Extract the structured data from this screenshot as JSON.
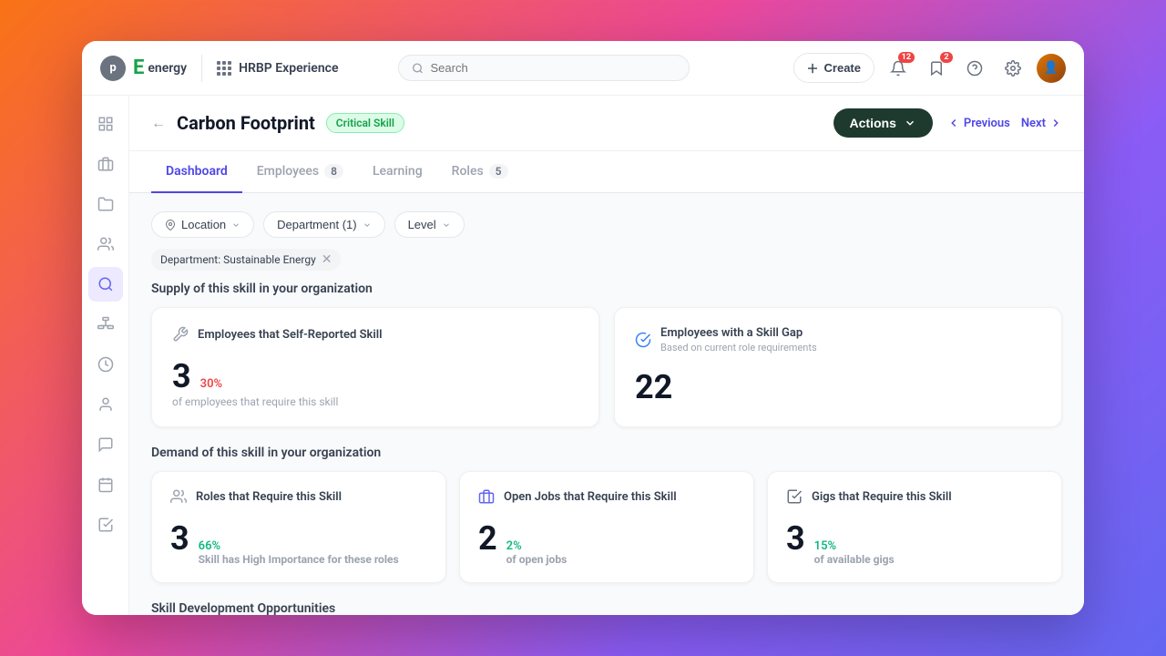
{
  "header": {
    "logo_letter": "E",
    "brand_name": "energy",
    "app_name": "HRBP Experience",
    "search_placeholder": "Search",
    "create_label": "Create",
    "notifications_count": "12",
    "bookmarks_count": "2"
  },
  "sidebar": {
    "items": [
      {
        "name": "dashboard",
        "icon": "⊞",
        "active": false
      },
      {
        "name": "briefcase",
        "icon": "💼",
        "active": false
      },
      {
        "name": "jobs",
        "icon": "🗂️",
        "active": false
      },
      {
        "name": "people",
        "icon": "👥",
        "active": false
      },
      {
        "name": "search",
        "icon": "🔍",
        "active": true
      },
      {
        "name": "org",
        "icon": "🏢",
        "active": false
      },
      {
        "name": "history",
        "icon": "🕐",
        "active": false
      },
      {
        "name": "person",
        "icon": "👤",
        "active": false
      },
      {
        "name": "chat",
        "icon": "💬",
        "active": false
      },
      {
        "name": "calendar",
        "icon": "📅",
        "active": false
      },
      {
        "name": "checklist",
        "icon": "✅",
        "active": false
      }
    ]
  },
  "page": {
    "back_label": "←",
    "title": "Carbon Footprint",
    "badge": "Critical Skill",
    "actions_label": "Actions",
    "prev_label": "Previous",
    "next_label": "Next"
  },
  "tabs": [
    {
      "label": "Dashboard",
      "count": null,
      "active": true
    },
    {
      "label": "Employees",
      "count": "8",
      "active": false
    },
    {
      "label": "Learning",
      "count": null,
      "active": false
    },
    {
      "label": "Roles",
      "count": "5",
      "active": false
    }
  ],
  "filters": {
    "location_label": "Location",
    "department_label": "Department (1)",
    "level_label": "Level",
    "active_tag": "Department: Sustainable Energy"
  },
  "supply_section": {
    "heading": "Supply of this skill in your organization",
    "card1": {
      "title": "Employees that Self-Reported Skill",
      "icon": "wrench",
      "number": "3",
      "percent": "30%",
      "desc": "of employees that require this skill"
    },
    "card2": {
      "title": "Employees with a Skill Gap",
      "subtitle": "Based on current role requirements",
      "icon": "check-circle",
      "number": "22"
    }
  },
  "demand_section": {
    "heading": "Demand of this skill in your organization",
    "card1": {
      "title": "Roles that Require this Skill",
      "icon": "people",
      "number": "3",
      "percent": "66%",
      "desc": "Skill has High Importance for these roles"
    },
    "card2": {
      "title": "Open Jobs that Require this Skill",
      "icon": "briefcase",
      "number": "2",
      "percent": "2%",
      "desc": "of open jobs"
    },
    "card3": {
      "title": "Gigs that Require this Skill",
      "icon": "checkbox",
      "number": "3",
      "percent": "15%",
      "desc": "of available gigs"
    }
  },
  "bottom_section": {
    "heading": "Skill Development Opportunities"
  }
}
